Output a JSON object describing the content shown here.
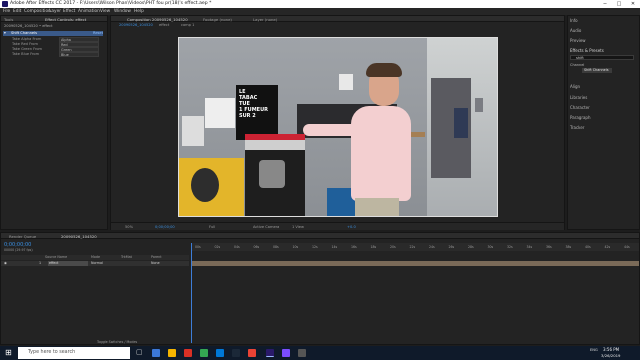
{
  "window": {
    "title": "Adobe After Effects CC 2017 - F:\\Users\\Wilson Phan\\Videos\\PHT fou pr(18)'s effect.aep *",
    "minimize": "─",
    "maximize": "□",
    "close": "✕"
  },
  "menu": [
    "File",
    "Edit",
    "Composition",
    "Layer",
    "Effect",
    "Animation",
    "View",
    "Window",
    "Help"
  ],
  "effect_controls": {
    "tab_tools": "Tools",
    "tab_label": "Effect Controls: effect",
    "breadcrumb": "20090526_104520 • effect",
    "effect_name": "Shift Channels",
    "reset": "Reset",
    "params": [
      {
        "label": "Take Alpha From",
        "value": "Alpha"
      },
      {
        "label": "Take Red From",
        "value": "Red"
      },
      {
        "label": "Take Green From",
        "value": "Green"
      },
      {
        "label": "Take Blue From",
        "value": "Blue"
      }
    ]
  },
  "composition": {
    "tab_comp": "Composition 20090526_104520",
    "tab_footage": "Footage (none)",
    "tab_layer": "Layer (none)",
    "sub_tabs": [
      "20090526_104520",
      "effect",
      "comp 1"
    ],
    "zoom": "50%",
    "timecode": "0;00;00;00",
    "resolution": "Full",
    "camera": "Active Camera",
    "views": "1 View",
    "exposure": "+0.0",
    "video_sign": {
      "line1": "LE",
      "line2": "TABAC",
      "line3": "TUE",
      "line4": "1 FUMEUR",
      "line5": "SUR 2"
    }
  },
  "right_panel": {
    "items": [
      "Info",
      "Audio",
      "Preview",
      "Effects & Presets",
      "Align",
      "Libraries",
      "Character",
      "Paragraph",
      "Tracker"
    ],
    "search_value": "shift",
    "tree_category": "Channel",
    "tree_item": "Shift Channels"
  },
  "timeline": {
    "tab_render": "Render Queue",
    "tab_comp": "20090526_104520",
    "timecode": "0;00;00;00",
    "fps": "00000 (29.97 fps)",
    "col_source": "Source Name",
    "col_mode": "Mode",
    "col_trkmat": "TrkMat",
    "col_parent": "Parent",
    "layer_num": "1",
    "layer_name": "effect",
    "layer_mode": "Normal",
    "layer_parent": "None",
    "ruler_ticks": [
      "00s",
      "02s",
      "04s",
      "06s",
      "08s",
      "10s",
      "12s",
      "14s",
      "16s",
      "18s",
      "20s",
      "22s",
      "24s",
      "26s",
      "28s",
      "30s",
      "32s",
      "34s",
      "36s",
      "38s",
      "40s",
      "42s",
      "44s"
    ],
    "footer": "Toggle Switches / Modes"
  },
  "taskbar": {
    "search_placeholder": "Type here to search",
    "time": "3:56 PM",
    "date": "3/26/2019",
    "lang": "ENG"
  }
}
